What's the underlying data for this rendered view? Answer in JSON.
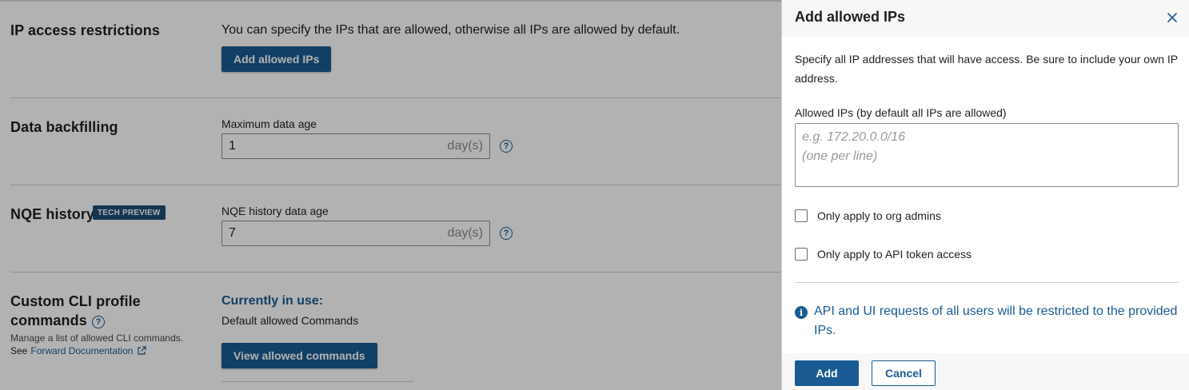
{
  "settings": {
    "ip_section": {
      "title": "IP access restrictions",
      "description": "You can specify the IPs that are allowed, otherwise all IPs are allowed by default.",
      "button_label": "Add allowed IPs"
    },
    "backfill_section": {
      "title": "Data backfilling",
      "field_label": "Maximum data age",
      "value": "1",
      "unit": "day(s)"
    },
    "nqe_section": {
      "title": "NQE history",
      "badge": "TECH PREVIEW",
      "field_label": "NQE history data age",
      "value": "7",
      "unit": "day(s)"
    },
    "cli_section": {
      "title_line1": "Custom CLI profile",
      "title_line2": "commands",
      "subtext": "Manage a list of allowed CLI commands.",
      "see_prefix": "See",
      "doc_link": "Forward Documentation",
      "in_use_label": "Currently in use:",
      "in_use_value": "Default allowed Commands",
      "button_label": "View allowed commands"
    }
  },
  "dialog": {
    "title": "Add allowed IPs",
    "description": "Specify all IP addresses that will have access. Be sure to include your own IP address.",
    "field_label": "Allowed IPs (by default all IPs are allowed)",
    "textarea_placeholder": "e.g. 172.20.0.0/16\n(one per line)",
    "checkbox_admins": "Only apply to org admins",
    "checkbox_api": "Only apply to API token access",
    "info_text": "API and UI requests of all users will be restricted to the provided IPs.",
    "add_label": "Add",
    "cancel_label": "Cancel"
  },
  "icons": {
    "help": "?",
    "info": "i",
    "close": "close-icon",
    "external_link": "external-link-icon"
  },
  "colors": {
    "primary": "#1a5b93",
    "badge": "#1d4e79",
    "overlay": "rgba(0,0,0,0.30)"
  }
}
